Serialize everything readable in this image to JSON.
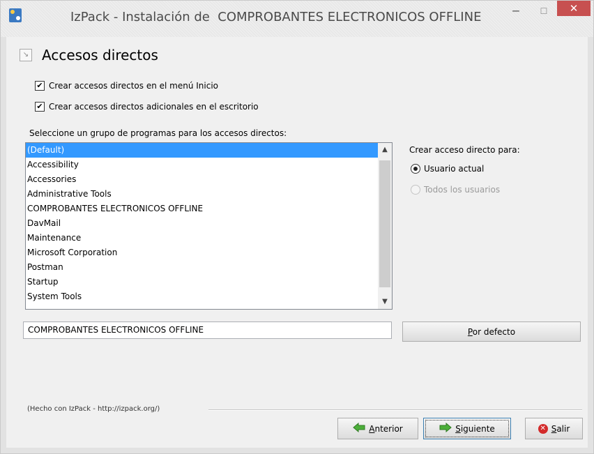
{
  "window": {
    "title": "IzPack - Instalación de  COMPROBANTES ELECTRONICOS OFFLINE",
    "minimize_glyph": "‒",
    "maximize_glyph": "☐",
    "close_glyph": "✕",
    "icon": "izpack-app-icon"
  },
  "panel": {
    "title": "Accesos directos",
    "title_icon": "shortcut-icon"
  },
  "options": {
    "start_menu": {
      "label": "Crear accesos directos en el menú Inicio",
      "checked": true
    },
    "desktop": {
      "label": "Crear accesos directos adicionales en el escritorio",
      "checked": true
    }
  },
  "program_group": {
    "label": "Seleccione un grupo de programas para los accesos directos:",
    "items": [
      "(Default)",
      "Accessibility",
      "Accessories",
      "Administrative Tools",
      "COMPROBANTES ELECTRONICOS OFFLINE",
      "DavMail",
      "Maintenance",
      "Microsoft Corporation",
      "Postman",
      "Startup",
      "System Tools"
    ],
    "selected": "(Default)",
    "value": "COMPROBANTES ELECTRONICOS OFFLINE",
    "default_button": {
      "accel": "P",
      "rest": "or defecto"
    }
  },
  "create_for": {
    "label": "Crear acceso directo para:",
    "current_user": {
      "label": "Usuario actual",
      "selected": true
    },
    "all_users": {
      "label": "Todos los usuarios",
      "enabled": false
    }
  },
  "footer": {
    "credit": "(Hecho con IzPack - http://izpack.org/)"
  },
  "nav": {
    "prev": {
      "accel": "A",
      "rest": "nterior"
    },
    "next": {
      "accel": "S",
      "rest": "iguiente"
    },
    "exit": {
      "accel": "S",
      "rest": "alir"
    }
  },
  "colors": {
    "selection": "#3399ff",
    "close_button": "#c75050",
    "arrow_green": "#3a9a2a"
  }
}
